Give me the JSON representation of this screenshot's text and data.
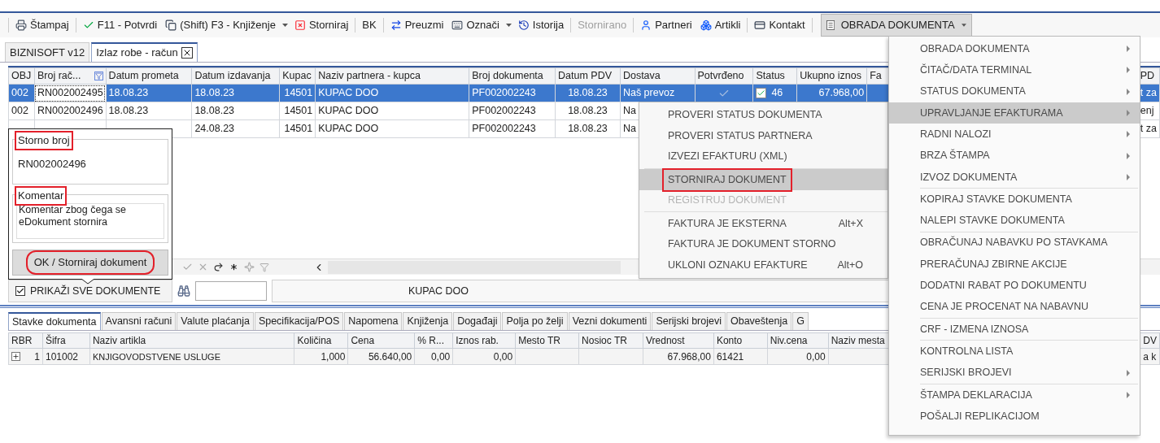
{
  "toolbar": {
    "items": [
      {
        "label": "Štampaj",
        "kind": "button",
        "disabled": false
      },
      {
        "label": "F11 - Potvrdi",
        "kind": "button",
        "disabled": false
      },
      {
        "label": "(Shift) F3 - Knjiženje",
        "kind": "dropdown",
        "disabled": false
      },
      {
        "label": "Storniraj",
        "kind": "button",
        "disabled": false
      },
      {
        "label": "BK",
        "kind": "button",
        "disabled": false
      },
      {
        "label": "Preuzmi",
        "kind": "button",
        "disabled": false
      },
      {
        "label": "Označi",
        "kind": "dropdown",
        "disabled": false
      },
      {
        "label": "Istorija",
        "kind": "button",
        "disabled": false
      },
      {
        "label": "Stornirano",
        "kind": "button",
        "disabled": true
      },
      {
        "label": "Partneri",
        "kind": "button",
        "disabled": false
      },
      {
        "label": "Artikli",
        "kind": "button",
        "disabled": false
      },
      {
        "label": "Kontakt",
        "kind": "button",
        "disabled": false
      }
    ],
    "menu_button": {
      "label": "OBRADA DOKUMENTA",
      "pressed": true
    }
  },
  "document_tabs": [
    {
      "label": "BIZNISOFT v12",
      "selected": false,
      "closable": false
    },
    {
      "label": "Izlaz robe - račun",
      "selected": true,
      "closable": true
    }
  ],
  "documents_table": {
    "columns": [
      "OBJ",
      "Broj rač...",
      "Datum prometa",
      "Datum izdavanja",
      "Kupac",
      "Naziv partnera - kupca",
      "Broj dokumenta",
      "Datum PDV",
      "Dostava",
      "Potvrđeno",
      "Status",
      "Ukupno iznos",
      "Fa",
      "PD"
    ],
    "rows": [
      {
        "selected": true,
        "confirmed": true,
        "status_checked": true,
        "cells": [
          "002",
          "RN002002495",
          "18.08.23",
          "18.08.23",
          "14501",
          "KUPAC DOO",
          "PF002002243",
          "18.08.23",
          "Naš prevoz",
          null,
          "46",
          "67.968,00",
          null,
          "t za"
        ]
      },
      {
        "selected": false,
        "cells": [
          "002",
          "RN002002496",
          "18.08.23",
          "18.08.23",
          "14501",
          "KUPAC DOO",
          "PF002002243",
          "18.08.23",
          "Na",
          null,
          null,
          null,
          null,
          "enj"
        ]
      },
      {
        "selected": false,
        "cells": [
          null,
          null,
          null,
          "24.08.23",
          "14501",
          "KUPAC DOO",
          "PF002002243",
          "18.08.23",
          "Na",
          null,
          null,
          null,
          null,
          "t za"
        ]
      }
    ]
  },
  "storno_popup": {
    "storno_label": "Storno broj",
    "storno_number": "RN002002496",
    "comment_label": "Komentar",
    "comment": "Komentar zbog čega se eDokument stornira",
    "ok_button": "OK / Storniraj dokument",
    "highlighted": true
  },
  "filter_bar": {
    "show_all": {
      "label": "PRIKAŽI SVE DOKUMENTE",
      "checked": true
    },
    "partner": "KUPAC DOO"
  },
  "context_menu": {
    "items": [
      {
        "kind": "item",
        "label": "PROVERI STATUS DOKUMENTA",
        "selected": false,
        "disabled": false
      },
      {
        "kind": "item",
        "label": "PROVERI STATUS PARTNERA",
        "selected": false,
        "disabled": false
      },
      {
        "kind": "item",
        "label": "IZVEZI EFAKTURU (XML)",
        "selected": false,
        "disabled": false
      },
      {
        "kind": "separator"
      },
      {
        "kind": "item",
        "label": "STORNIRAJ DOKUMENT",
        "selected": true,
        "disabled": false,
        "highlighted": true
      },
      {
        "kind": "item",
        "label": "REGISTRUJ DOKUMENT",
        "selected": false,
        "disabled": true
      },
      {
        "kind": "separator"
      },
      {
        "kind": "item",
        "label": "FAKTURA JE EKSTERNA",
        "shortcut": "Alt+X",
        "selected": false,
        "disabled": false
      },
      {
        "kind": "item",
        "label": "FAKTURA JE DOKUMENT STORNO",
        "selected": false,
        "disabled": false
      },
      {
        "kind": "item",
        "label": "UKLONI OZNAKU EFAKTURE",
        "shortcut": "Alt+O",
        "selected": false,
        "disabled": false
      }
    ]
  },
  "main_menu": {
    "items": [
      {
        "kind": "item",
        "label": "OBRADA DOKUMENTA",
        "submenu": true,
        "selected": false
      },
      {
        "kind": "item",
        "label": "ČITAČ/DATA TERMINAL",
        "submenu": true,
        "selected": false
      },
      {
        "kind": "item",
        "label": "STATUS DOKUMENTA",
        "submenu": true,
        "selected": false
      },
      {
        "kind": "item",
        "label": "UPRAVLJANJE EFAKTURAMA",
        "submenu": true,
        "selected": true
      },
      {
        "kind": "item",
        "label": "RADNI NALOZI",
        "submenu": true,
        "selected": false
      },
      {
        "kind": "item",
        "label": "BRZA ŠTAMPA",
        "submenu": true,
        "selected": false
      },
      {
        "kind": "item",
        "label": "IZVOZ DOKUMENTA",
        "submenu": true,
        "selected": false
      },
      {
        "kind": "separator"
      },
      {
        "kind": "item",
        "label": "KOPIRAJ STAVKE DOKUMENTA",
        "submenu": false,
        "selected": false
      },
      {
        "kind": "item",
        "label": "NALEPI STAVKE DOKUMENTA",
        "submenu": false,
        "selected": false
      },
      {
        "kind": "separator"
      },
      {
        "kind": "item",
        "label": "OBRAČUNAJ NABAVKU PO STAVKAMA",
        "submenu": false,
        "selected": false
      },
      {
        "kind": "item",
        "label": "PRERAČUNAJ ZBIRNE AKCIJE",
        "submenu": false,
        "selected": false
      },
      {
        "kind": "item",
        "label": "DODATNI RABAT PO DOKUMENTU",
        "submenu": false,
        "selected": false
      },
      {
        "kind": "item",
        "label": "CENA JE PROCENAT NA NABAVNU",
        "submenu": false,
        "selected": false
      },
      {
        "kind": "separator"
      },
      {
        "kind": "item",
        "label": "CRF - IZMENA IZNOSA",
        "submenu": false,
        "selected": false
      },
      {
        "kind": "separator"
      },
      {
        "kind": "item",
        "label": "KONTROLNA LISTA",
        "submenu": false,
        "selected": false
      },
      {
        "kind": "item",
        "label": "SERIJSKI BROJEVI",
        "submenu": true,
        "selected": false
      },
      {
        "kind": "separator"
      },
      {
        "kind": "item",
        "label": "ŠTAMPA DEKLARACIJA",
        "submenu": true,
        "selected": false
      },
      {
        "kind": "item",
        "label": "POŠALJI REPLIKACIJOM",
        "submenu": false,
        "selected": false
      }
    ]
  },
  "bottom_tabs": [
    {
      "label": "Stavke dokumenta",
      "selected": true
    },
    {
      "label": "Avansni računi",
      "selected": false
    },
    {
      "label": "Valute plaćanja",
      "selected": false
    },
    {
      "label": "Specifikacija/POS",
      "selected": false
    },
    {
      "label": "Napomena",
      "selected": false
    },
    {
      "label": "Knjiženja",
      "selected": false
    },
    {
      "label": "Događaji",
      "selected": false
    },
    {
      "label": "Polja po želji",
      "selected": false
    },
    {
      "label": "Vezni dokumenti",
      "selected": false
    },
    {
      "label": "Serijski brojevi",
      "selected": false
    },
    {
      "label": "Obaveštenja",
      "selected": false
    },
    {
      "label": "G",
      "selected": false
    }
  ],
  "items_table": {
    "columns": [
      "RBR",
      "Šifra",
      "Naziv artikla",
      "Količina",
      "Cena",
      "% R...",
      "Iznos rab.",
      "Mesto TR",
      "Nosioc TR",
      "Vrednost",
      "Konto",
      "Niv.cena",
      "Naziv mesta",
      "DV"
    ],
    "rows": [
      {
        "expanded": false,
        "cells": [
          "1",
          "101002",
          "KNJIGOVODSTVENE USLUGE",
          "1,000",
          "56.640,00",
          "0,00",
          "0,00",
          null,
          null,
          "67.968,00",
          "61421",
          "0,00",
          null,
          "a k"
        ]
      }
    ]
  }
}
